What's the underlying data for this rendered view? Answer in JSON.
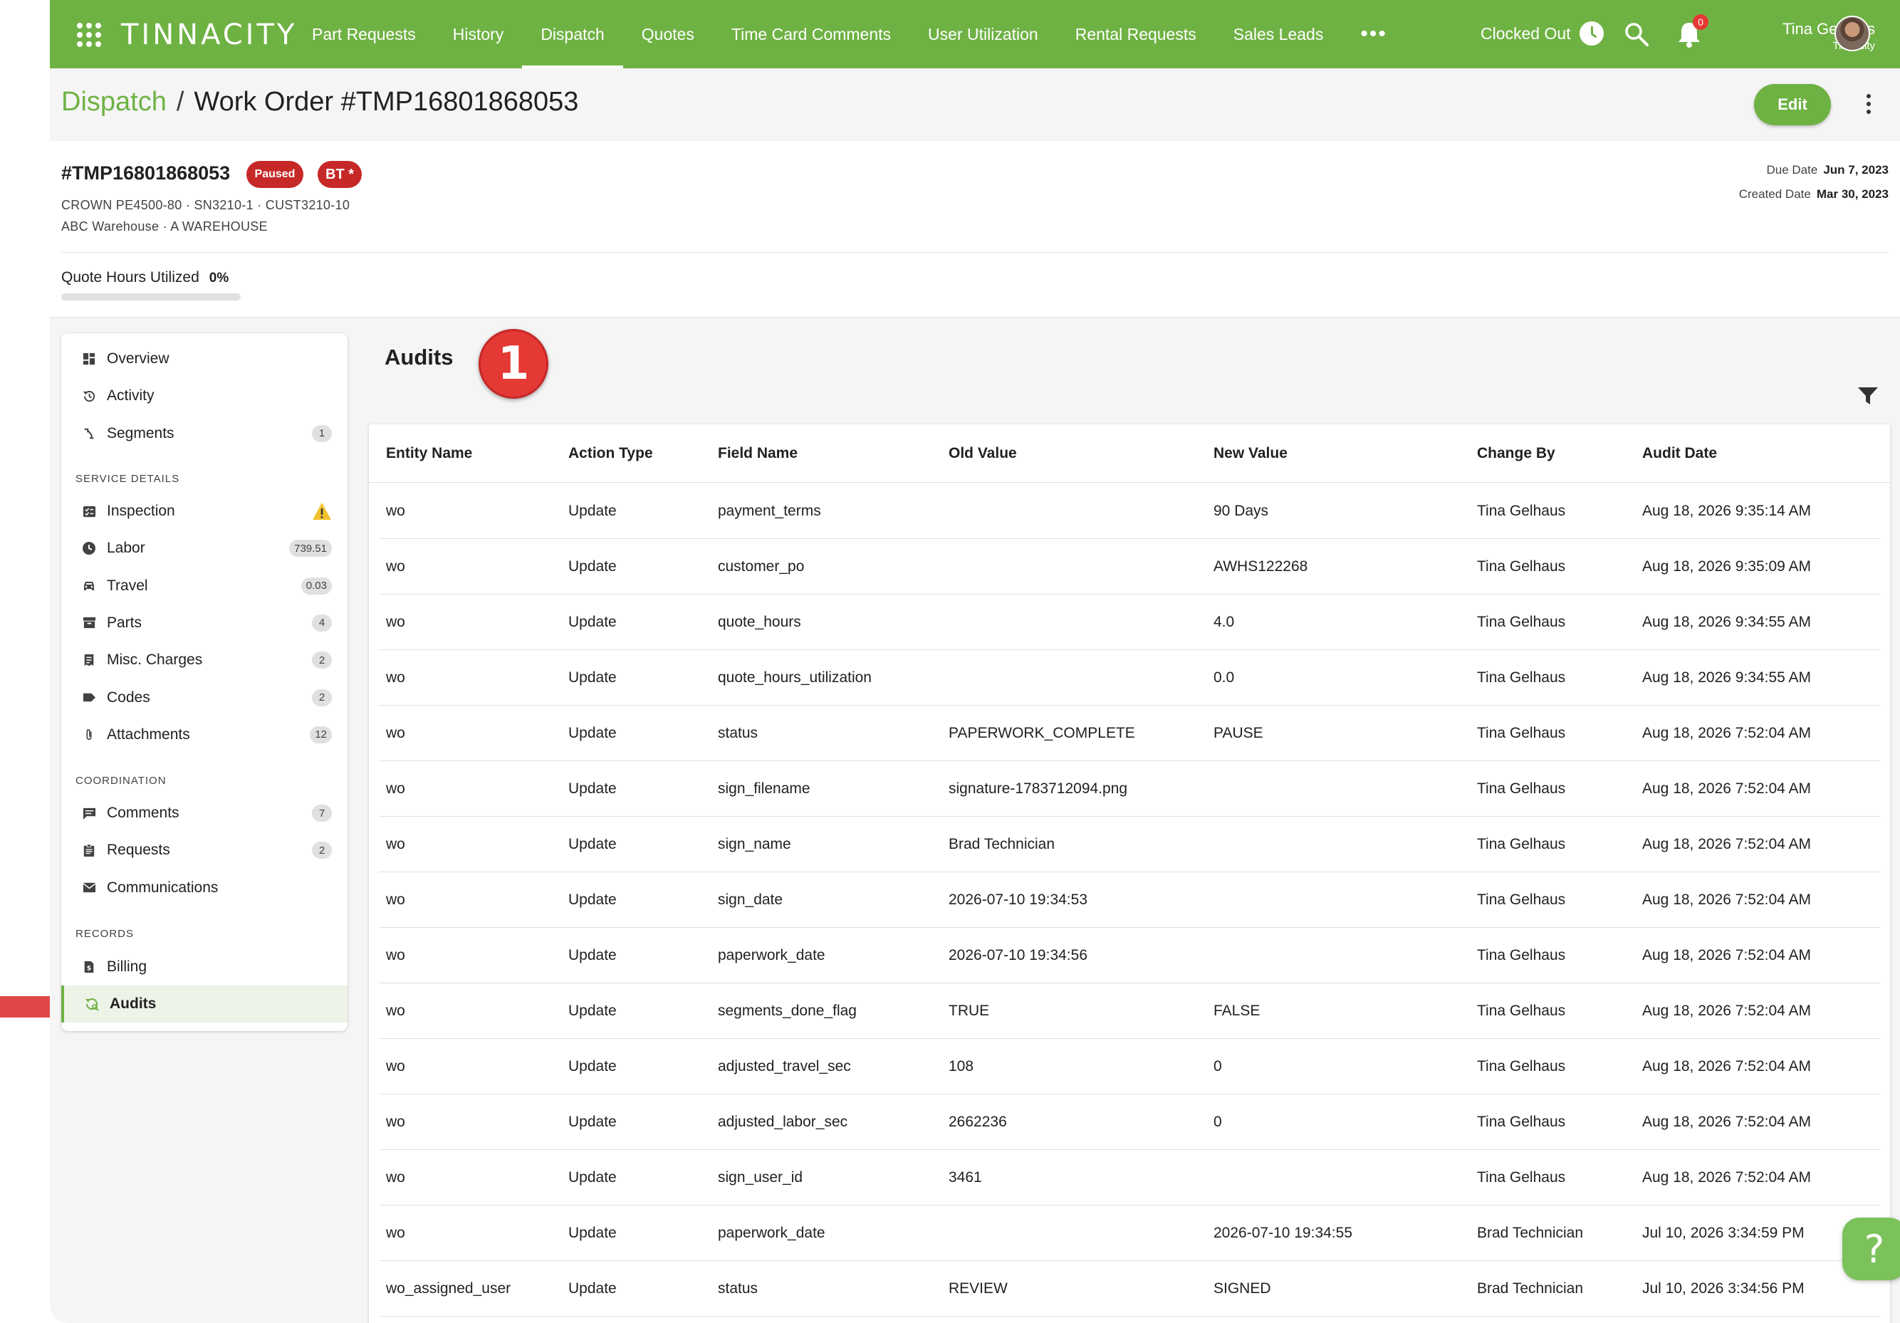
{
  "app": {
    "logo_text": "TINNACITY",
    "nav": [
      {
        "label": "Part Requests"
      },
      {
        "label": "History"
      },
      {
        "label": "Dispatch",
        "active": true
      },
      {
        "label": "Quotes"
      },
      {
        "label": "Time Card Comments"
      },
      {
        "label": "User Utilization"
      },
      {
        "label": "Rental Requests"
      },
      {
        "label": "Sales Leads"
      }
    ],
    "more_label": "•••",
    "clock_status": "Clocked Out",
    "notifications_count": "0",
    "user": {
      "name": "Tina Gelhaus",
      "org": "Tinnacity"
    },
    "accent_color": "#6fb244"
  },
  "header": {
    "breadcrumb_root": "Dispatch",
    "breadcrumb_sep": "/",
    "breadcrumb_current": "Work Order #TMP16801868053",
    "edit_label": "Edit"
  },
  "work_order": {
    "id": "#TMP16801868053",
    "status_badge": "Paused",
    "tag_badge": "BT *",
    "equipment_line": "CROWN PE4500-80 · SN3210-1 · CUST3210-10",
    "location_line": "ABC Warehouse · A WAREHOUSE",
    "due_date_label": "Due Date",
    "due_date": "Jun 7, 2023",
    "created_date_label": "Created Date",
    "created_date": "Mar 30, 2023",
    "quote_hours_label": "Quote Hours Utilized",
    "quote_hours_value": "0%",
    "quote_hours_fraction": 0
  },
  "sidebar": {
    "items_top": [
      {
        "label": "Overview",
        "icon": "dashboard-icon"
      },
      {
        "label": "Activity",
        "icon": "history-icon"
      },
      {
        "label": "Segments",
        "icon": "segments-icon",
        "count": "1"
      }
    ],
    "section_service": "SERVICE DETAILS",
    "items_service": [
      {
        "label": "Inspection",
        "icon": "inspection-icon",
        "warning": true
      },
      {
        "label": "Labor",
        "icon": "clock-icon",
        "count": "739.51"
      },
      {
        "label": "Travel",
        "icon": "car-icon",
        "count": "0.03"
      },
      {
        "label": "Parts",
        "icon": "box-icon",
        "count": "4"
      },
      {
        "label": "Misc. Charges",
        "icon": "receipt-icon",
        "count": "2"
      },
      {
        "label": "Codes",
        "icon": "tag-icon",
        "count": "2"
      },
      {
        "label": "Attachments",
        "icon": "paperclip-icon",
        "count": "12"
      }
    ],
    "section_coordination": "COORDINATION",
    "items_coordination": [
      {
        "label": "Comments",
        "icon": "comment-icon",
        "count": "7"
      },
      {
        "label": "Requests",
        "icon": "clipboard-icon",
        "count": "2"
      },
      {
        "label": "Communications",
        "icon": "mail-icon"
      }
    ],
    "section_records": "RECORDS",
    "items_records": [
      {
        "label": "Billing",
        "icon": "invoice-icon"
      },
      {
        "label": "Audits",
        "icon": "audit-icon",
        "active": true
      }
    ]
  },
  "audits": {
    "title": "Audits",
    "step_marker": "1",
    "columns": [
      "Entity Name",
      "Action Type",
      "Field Name",
      "Old Value",
      "New Value",
      "Change By",
      "Audit Date"
    ],
    "rows": [
      [
        "wo",
        "Update",
        "payment_terms",
        "",
        "90 Days",
        "Tina Gelhaus",
        "Aug 18, 2026 9:35:14 AM"
      ],
      [
        "wo",
        "Update",
        "customer_po",
        "",
        "AWHS122268",
        "Tina Gelhaus",
        "Aug 18, 2026 9:35:09 AM"
      ],
      [
        "wo",
        "Update",
        "quote_hours",
        "",
        "4.0",
        "Tina Gelhaus",
        "Aug 18, 2026 9:34:55 AM"
      ],
      [
        "wo",
        "Update",
        "quote_hours_utilization",
        "",
        "0.0",
        "Tina Gelhaus",
        "Aug 18, 2026 9:34:55 AM"
      ],
      [
        "wo",
        "Update",
        "status",
        "PAPERWORK_COMPLETE",
        "PAUSE",
        "Tina Gelhaus",
        "Aug 18, 2026 7:52:04 AM"
      ],
      [
        "wo",
        "Update",
        "sign_filename",
        "signature-1783712094.png",
        "",
        "Tina Gelhaus",
        "Aug 18, 2026 7:52:04 AM"
      ],
      [
        "wo",
        "Update",
        "sign_name",
        "Brad Technician",
        "",
        "Tina Gelhaus",
        "Aug 18, 2026 7:52:04 AM"
      ],
      [
        "wo",
        "Update",
        "sign_date",
        "2026-07-10 19:34:53",
        "",
        "Tina Gelhaus",
        "Aug 18, 2026 7:52:04 AM"
      ],
      [
        "wo",
        "Update",
        "paperwork_date",
        "2026-07-10 19:34:56",
        "",
        "Tina Gelhaus",
        "Aug 18, 2026 7:52:04 AM"
      ],
      [
        "wo",
        "Update",
        "segments_done_flag",
        "TRUE",
        "FALSE",
        "Tina Gelhaus",
        "Aug 18, 2026 7:52:04 AM"
      ],
      [
        "wo",
        "Update",
        "adjusted_travel_sec",
        "108",
        "0",
        "Tina Gelhaus",
        "Aug 18, 2026 7:52:04 AM"
      ],
      [
        "wo",
        "Update",
        "adjusted_labor_sec",
        "2662236",
        "0",
        "Tina Gelhaus",
        "Aug 18, 2026 7:52:04 AM"
      ],
      [
        "wo",
        "Update",
        "sign_user_id",
        "3461",
        "",
        "Tina Gelhaus",
        "Aug 18, 2026 7:52:04 AM"
      ],
      [
        "wo",
        "Update",
        "paperwork_date",
        "",
        "2026-07-10 19:34:55",
        "Brad Technician",
        "Jul 10, 2026 3:34:59 PM"
      ],
      [
        "wo_assigned_user",
        "Update",
        "status",
        "REVIEW",
        "SIGNED",
        "Brad Technician",
        "Jul 10, 2026 3:34:56 PM"
      ]
    ]
  },
  "help_label": "?"
}
